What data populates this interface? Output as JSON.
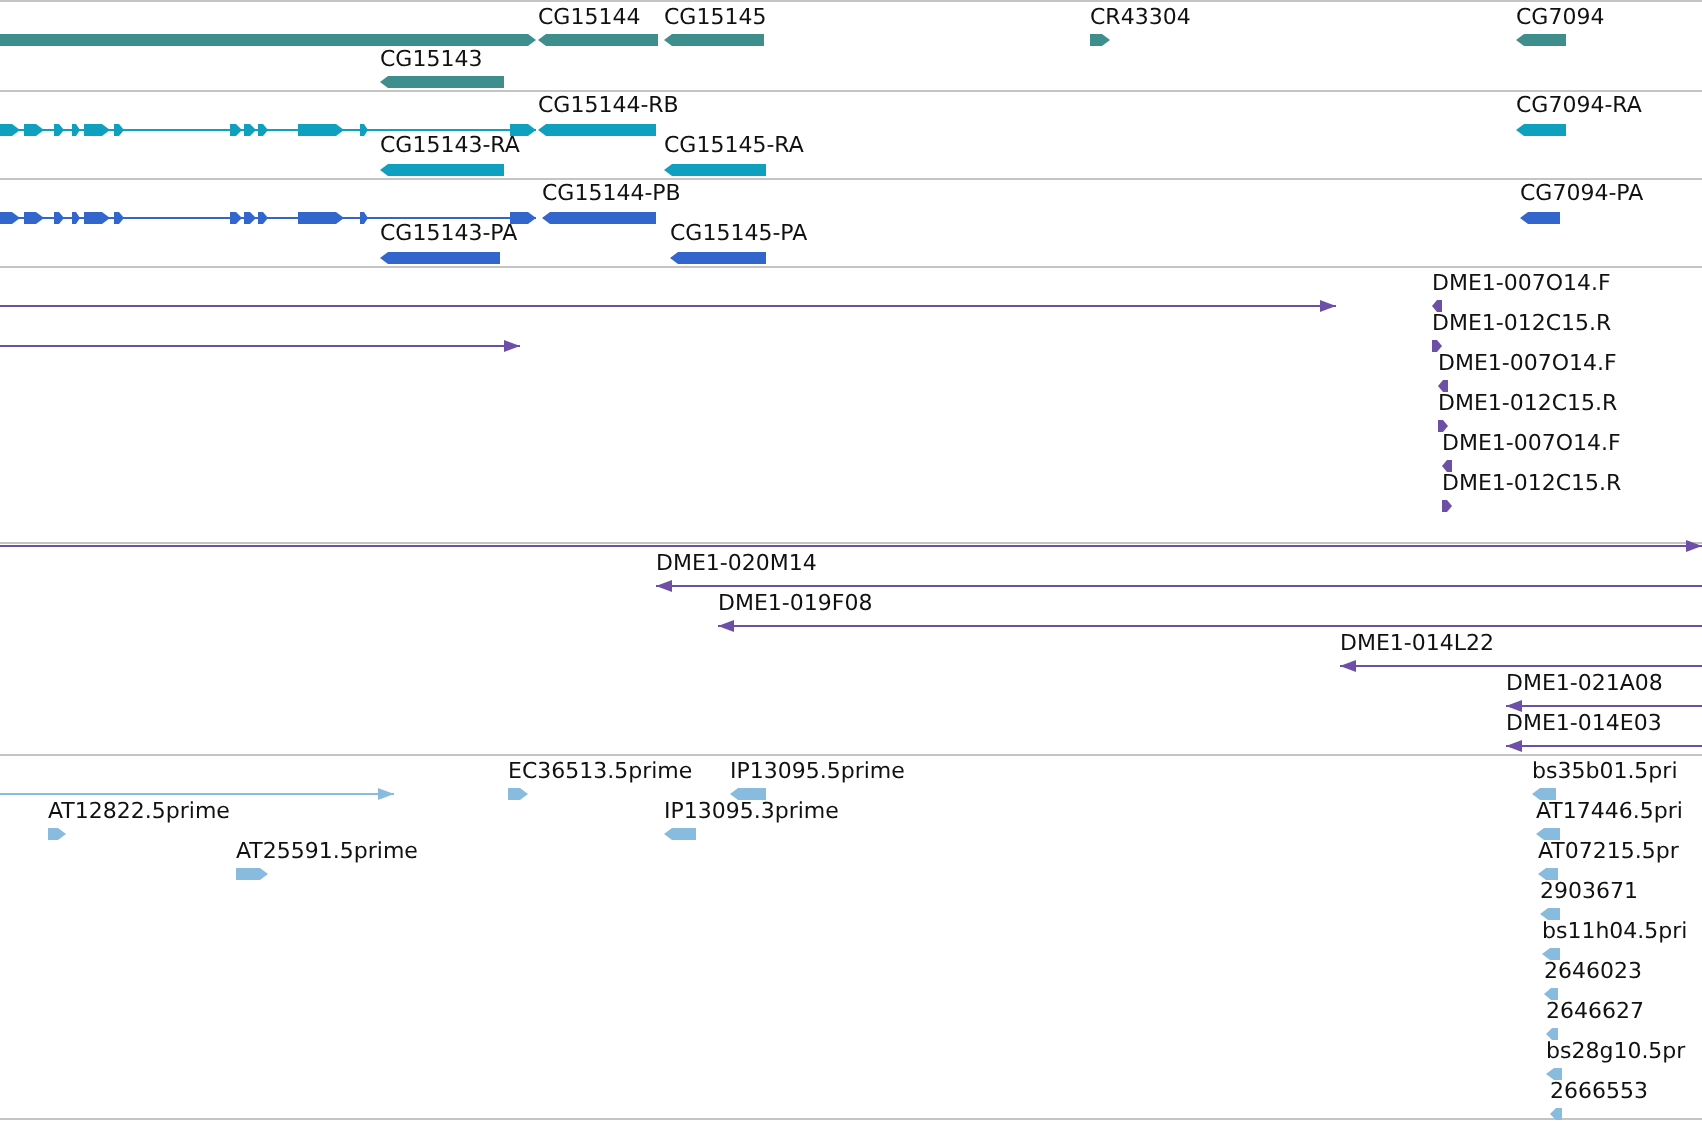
{
  "tracks": [
    {
      "kind": "gene",
      "features": [
        {
          "forward": true
        },
        {
          "label": "CG15144",
          "forward": false
        },
        {
          "label": "CG15145",
          "forward": false
        },
        {
          "label": "CG15143",
          "forward": false
        },
        {
          "label": "CR43304",
          "forward": true
        },
        {
          "label": "CG7094",
          "forward": false
        }
      ]
    },
    {
      "kind": "transcript",
      "features": [
        {
          "forward": true
        },
        {
          "label": "CG15144-RB",
          "forward": false
        },
        {
          "label": "CG15143-RA",
          "forward": false
        },
        {
          "label": "CG15145-RA",
          "forward": false
        },
        {
          "label": "CG7094-RA",
          "forward": false
        }
      ]
    },
    {
      "kind": "protein",
      "features": [
        {
          "forward": true
        },
        {
          "label": "CG15144-PB",
          "forward": false
        },
        {
          "label": "CG15143-PA",
          "forward": false
        },
        {
          "label": "CG15145-PA",
          "forward": false
        },
        {
          "label": "CG7094-PA",
          "forward": false
        }
      ]
    },
    {
      "kind": "clone_end",
      "features": [
        {
          "forward": true
        },
        {
          "forward": true
        },
        {
          "label": "DME1-007O14.F",
          "forward": false
        },
        {
          "label": "DME1-012C15.R",
          "forward": true
        },
        {
          "label": "DME1-007O14.F",
          "forward": false
        },
        {
          "label": "DME1-012C15.R",
          "forward": true
        },
        {
          "label": "DME1-007O14.F",
          "forward": false
        },
        {
          "label": "DME1-012C15.R",
          "forward": true
        }
      ]
    },
    {
      "kind": "clone",
      "features": [
        {
          "forward": true
        },
        {
          "label": "DME1-020M14",
          "forward": false
        },
        {
          "label": "DME1-019F08",
          "forward": false
        },
        {
          "label": "DME1-014L22",
          "forward": false
        },
        {
          "label": "DME1-021A08",
          "forward": false
        },
        {
          "label": "DME1-014E03",
          "forward": false
        }
      ]
    },
    {
      "kind": "est",
      "features": [
        {
          "forward": true
        },
        {
          "label": "EC36513.5prime",
          "forward": true
        },
        {
          "label": "IP13095.5prime",
          "forward": false
        },
        {
          "label": "bs35b01.5pri",
          "forward": false
        },
        {
          "label": "AT12822.5prime",
          "forward": true
        },
        {
          "label": "IP13095.3prime",
          "forward": false
        },
        {
          "label": "AT17446.5pri",
          "forward": false
        },
        {
          "label": "AT25591.5prime",
          "forward": true
        },
        {
          "label": "AT07215.5pr",
          "forward": false
        },
        {
          "label": "2903671",
          "forward": false
        },
        {
          "label": "bs11h04.5pri",
          "forward": false
        },
        {
          "label": "2646023",
          "forward": false
        },
        {
          "label": "2646627",
          "forward": false
        },
        {
          "label": "bs28g10.5pr",
          "forward": false
        },
        {
          "label": "2666553",
          "forward": false
        }
      ]
    }
  ]
}
